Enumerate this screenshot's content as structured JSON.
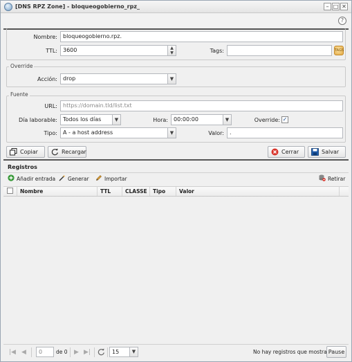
{
  "window": {
    "title": "[DNS RPZ Zone] - bloqueogobierno_rpz_",
    "controls": {
      "minimize": "–",
      "maximize": "□",
      "close": "✕"
    },
    "help": "?"
  },
  "form": {
    "nombre": {
      "label": "Nombre:",
      "value": "bloqueogobierno.rpz."
    },
    "ttl": {
      "label": "TTL:",
      "value": "3600"
    },
    "tags": {
      "label": "Tags:",
      "value": ""
    },
    "override_section": {
      "legend": "Override",
      "accion": {
        "label": "Acción:",
        "value": "drop"
      }
    },
    "fuente_section": {
      "legend": "Fuente",
      "url": {
        "label": "URL:",
        "placeholder": "https://domain.tld/list.txt"
      },
      "dia": {
        "label": "Día laborable:",
        "value": "Todos los días"
      },
      "hora": {
        "label": "Hora:",
        "value": "00:00:00"
      },
      "override": {
        "label": "Override:",
        "checked": true
      },
      "tipo": {
        "label": "Tipo:",
        "value": "A - a host address"
      },
      "valor": {
        "label": "Valor:",
        "value": "."
      }
    }
  },
  "actions": {
    "copiar": "Copiar",
    "recargar": "Recargar",
    "cerrar": "Cerrar",
    "salvar": "Salvar"
  },
  "registros": {
    "title": "Registros",
    "toolbar": {
      "add": "Añadir entrada",
      "generar": "Generar",
      "importar": "Importar",
      "retirar": "Retirar"
    },
    "columns": [
      "Nombre",
      "TTL",
      "CLASSE",
      "Tipo",
      "Valor"
    ],
    "rows": []
  },
  "pager": {
    "page": "0",
    "of_label": "de 0",
    "page_size": "15",
    "empty_msg": "No hay registros que mostrar",
    "pause": "Pause"
  },
  "colors": {
    "accent": "#1a4d8f",
    "close_red": "#d9342b",
    "save_blue": "#1d5aa8",
    "add_green": "#3a9a3a"
  }
}
